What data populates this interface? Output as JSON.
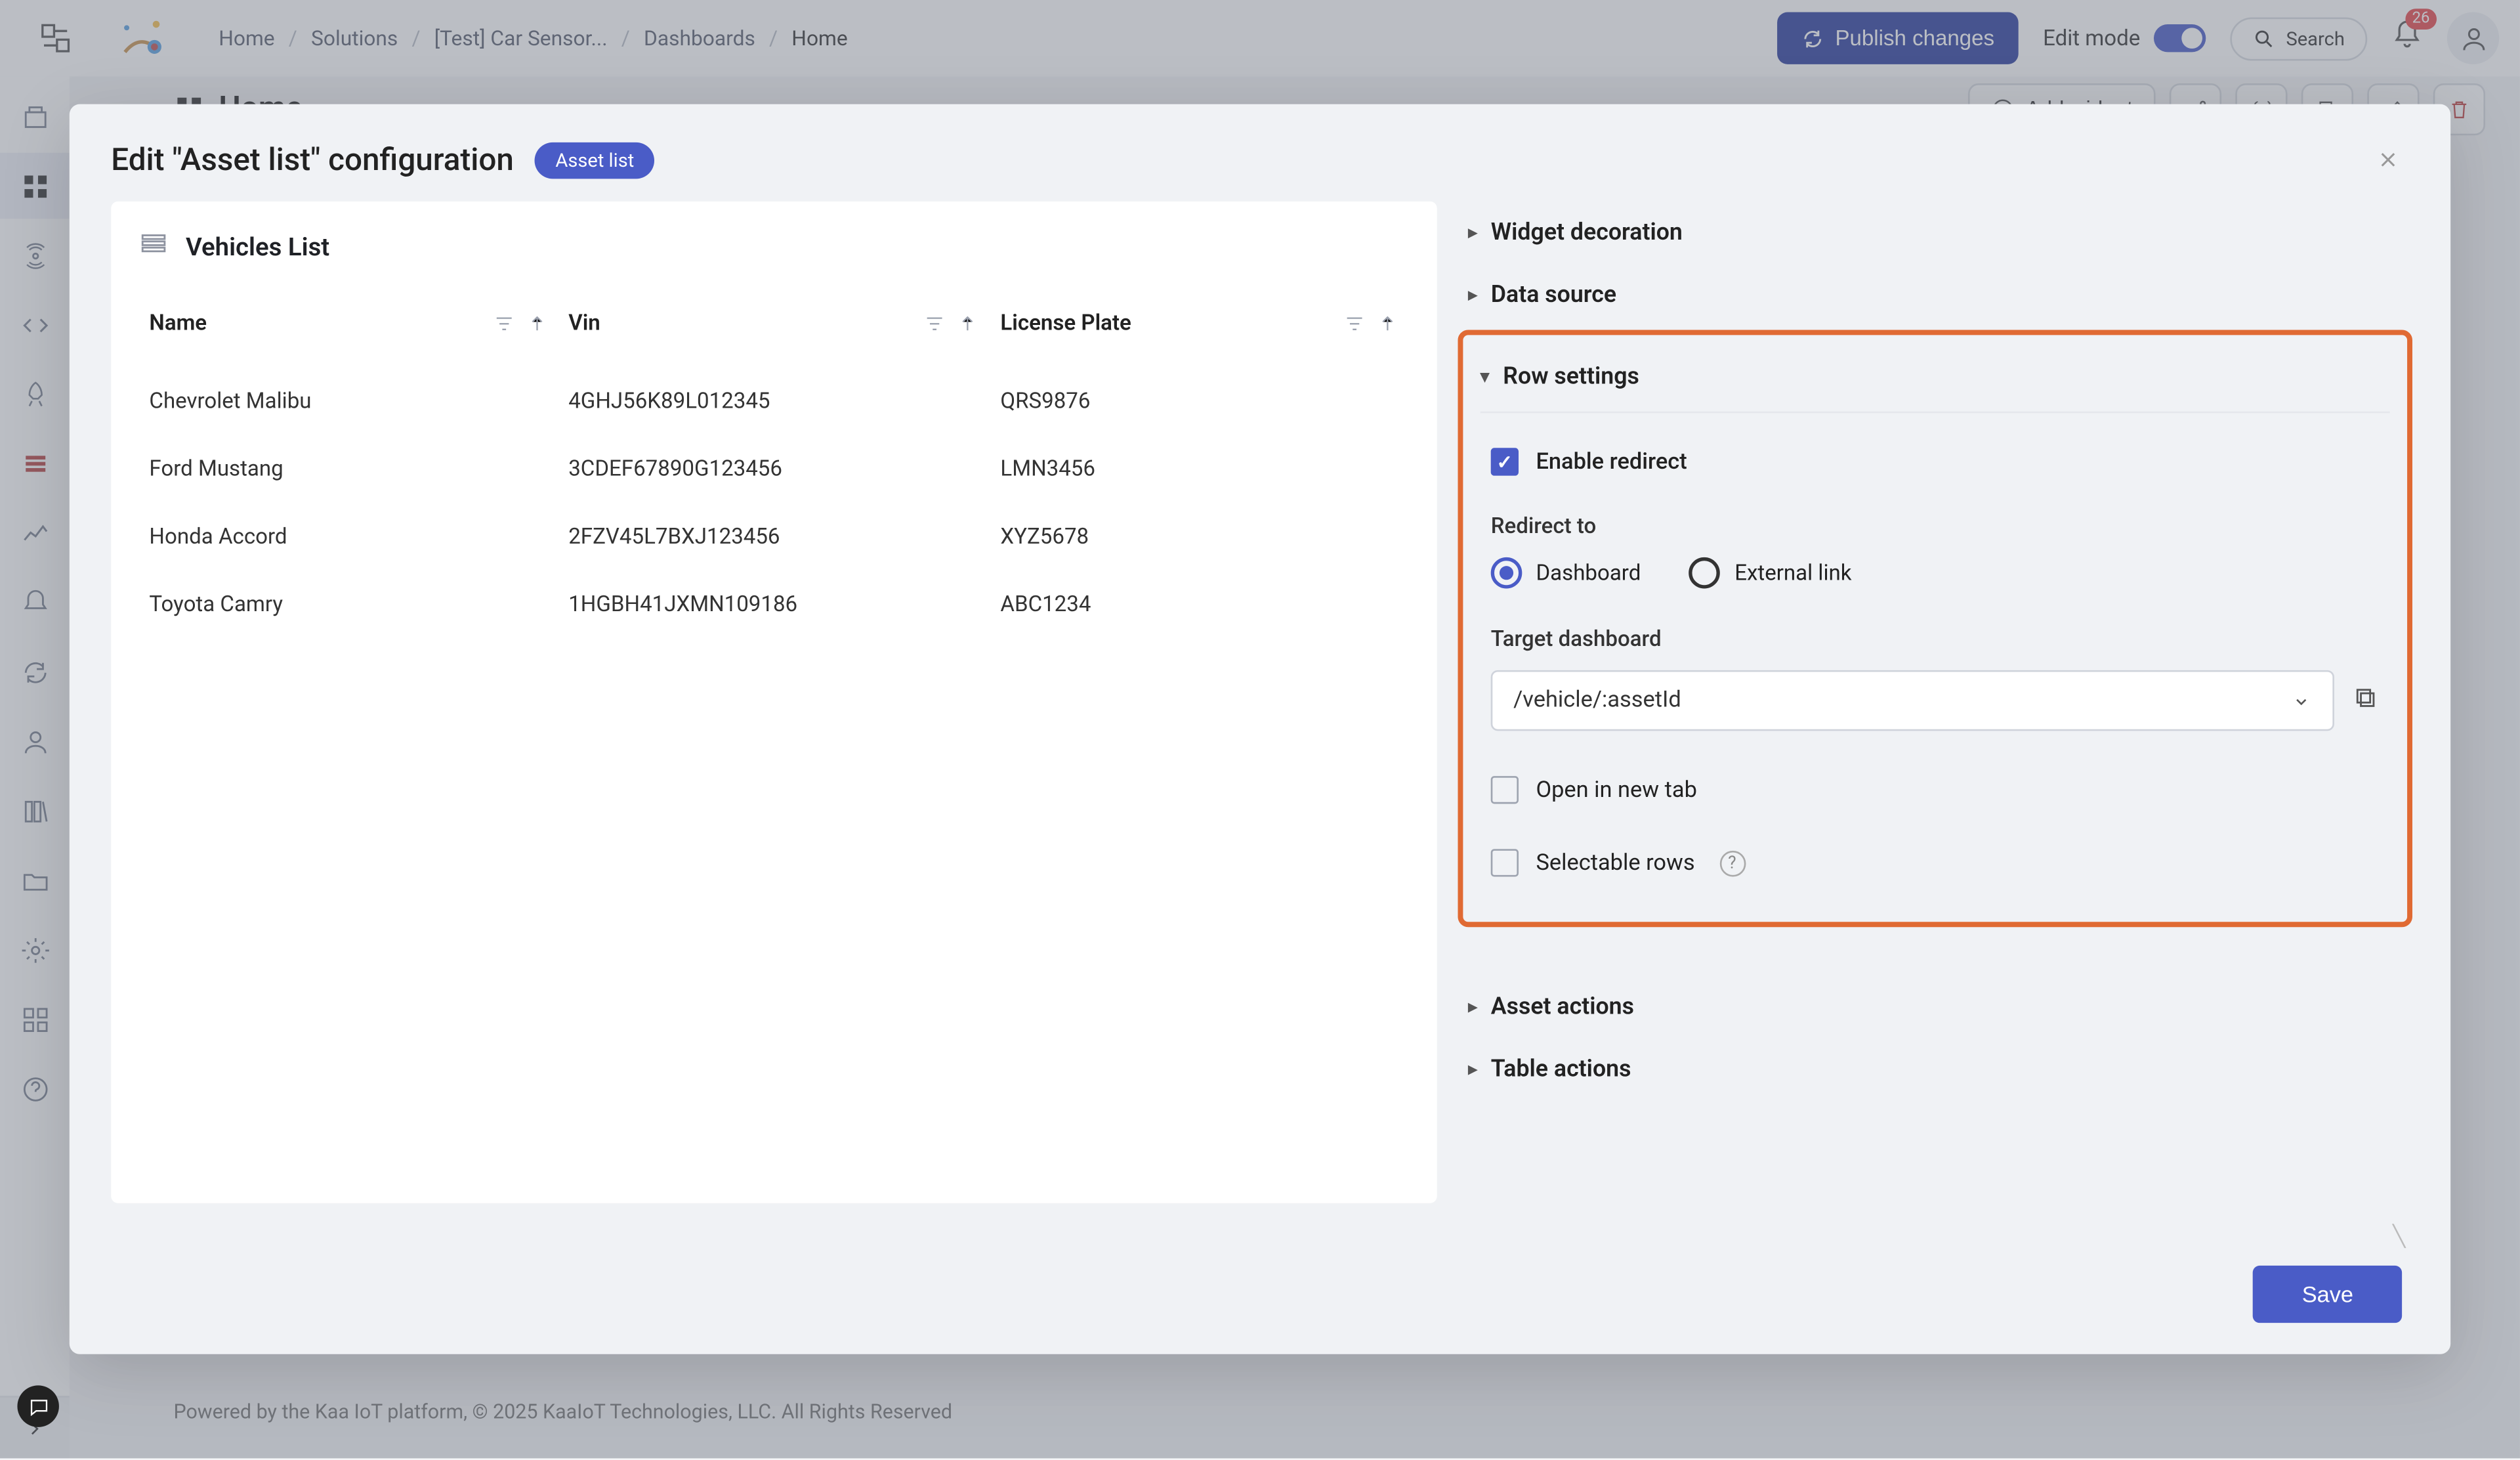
{
  "breadcrumbs": {
    "home": "Home",
    "solutions": "Solutions",
    "project": "[Test] Car Sensor...",
    "dashboards": "Dashboards",
    "current": "Home"
  },
  "top": {
    "publish": "Publish changes",
    "edit_mode": "Edit mode",
    "search": "Search",
    "notifications_count": "26"
  },
  "page": {
    "title": "Home",
    "add_widget": "Add widget"
  },
  "footer": "Powered by the Kaa IoT platform, © 2025 KaaIoT Technologies, LLC. All Rights Reserved",
  "modal": {
    "title": "Edit \"Asset list\" configuration",
    "chip": "Asset list",
    "save": "Save"
  },
  "preview": {
    "title": "Vehicles List",
    "columns": {
      "name": "Name",
      "vin": "Vin",
      "plate": "License Plate"
    },
    "rows": [
      {
        "name": "Chevrolet Malibu",
        "vin": "4GHJ56K89L012345",
        "plate": "QRS9876"
      },
      {
        "name": "Ford Mustang",
        "vin": "3CDEF67890G123456",
        "plate": "LMN3456"
      },
      {
        "name": "Honda Accord",
        "vin": "2FZV45L7BXJ123456",
        "plate": "XYZ5678"
      },
      {
        "name": "Toyota Camry",
        "vin": "1HGBH41JXMN109186",
        "plate": "ABC1234"
      }
    ]
  },
  "settings": {
    "widget_decoration": "Widget decoration",
    "data_source": "Data source",
    "row_settings": "Row settings",
    "enable_redirect": "Enable redirect",
    "redirect_to": "Redirect to",
    "radio_dashboard": "Dashboard",
    "radio_external": "External link",
    "target_dashboard": "Target dashboard",
    "target_value": "/vehicle/:assetId",
    "open_new_tab": "Open in new tab",
    "selectable_rows": "Selectable rows",
    "asset_actions": "Asset actions",
    "table_actions": "Table actions"
  }
}
